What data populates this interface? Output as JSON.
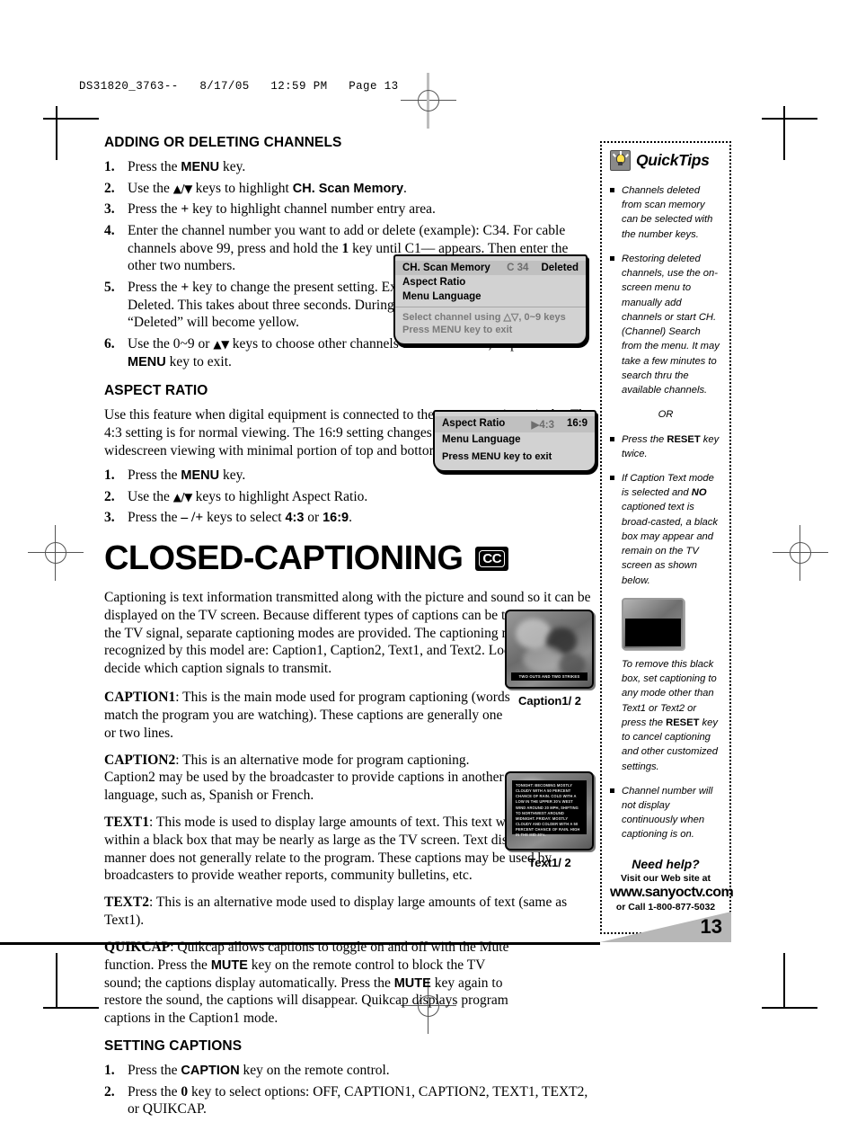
{
  "print_header": "DS31820_3763--   8/17/05   12:59 PM   Page 13",
  "sections": {
    "adding": {
      "heading": "ADDING OR DELETING CHANNELS",
      "steps": [
        {
          "num": "1.",
          "html": "Press the <span class=\"b\">MENU</span> key."
        },
        {
          "num": "2.",
          "html": "Use the <span class=\"ar\">▲/▼</span> keys to highlight <span class=\"b\">CH. Scan Memory</span>."
        },
        {
          "num": "3.",
          "html": "Press the <span class=\"bs\">+</span> key to highlight channel number entry area."
        },
        {
          "num": "4.",
          "html": "Enter the channel number you want to add or delete (example):  C34. For cable channels above 99, press and hold the <span class=\"bs\">1</span> key until C1&ndash;&ndash; appears. Then enter the other two numbers."
        },
        {
          "num": "5.",
          "html": "Press the <span class=\"bs\">+</span> key to change the present setting. Example: Added will change to Deleted. This takes about three seconds. During that time, the word &ldquo;Added&rdquo; or &ldquo;Deleted&rdquo; will become yellow."
        },
        {
          "num": "6.",
          "html": "Use the 0~9 or <span class=\"ar\">▲▼</span> keys to choose other channels to delete or add, or press the <span class=\"b\">MENU</span> key to exit."
        }
      ]
    },
    "aspect": {
      "heading": "ASPECT RATIO",
      "body": "Use this feature when digital equipment is connected to the component input jacks. The 4:3 setting is for normal viewing. The 16:9 setting changes the picture image to widescreen viewing with minimal portion of top and bottom compressed.",
      "steps": [
        {
          "num": "1.",
          "html": "Press the <span class=\"b\">MENU</span> key."
        },
        {
          "num": "2.",
          "html": "Use the <span class=\"ar\">▲/▼</span> keys to highlight Aspect Ratio."
        },
        {
          "num": "3.",
          "html": "Press the <span class=\"bs\">– /+</span> keys to select <span class=\"b\">4:3</span> or <span class=\"b\">16:9</span>."
        }
      ]
    },
    "closed_captioning": {
      "title": "CLOSED-CAPTIONING",
      "badge": "CC",
      "intro": "Captioning is text information transmitted along with the picture and sound so it can be displayed on the TV screen. Because different types of captions can be transmitted with the TV signal, separate captioning modes are provided. The captioning modes recognized by this model are: Caption1, Caption2, Text1, and Text2. Local broadcasters decide which caption signals to transmit.",
      "modes": [
        {
          "label": "CAPTION1",
          "text": ": This is the main mode used for program captioning (words match the program you are watching). These captions are generally one or two lines."
        },
        {
          "label": "CAPTION2",
          "text": ": This is an alternative mode for program captioning. Caption2 may be used by the broadcaster to provide captions in another language, such as, Spanish or French."
        },
        {
          "label": "TEXT1",
          "text": ": This mode is used to display large amounts of text. This text will appear within a black box that may be nearly as large as the TV screen. Text displayed in this manner does not generally relate to the program. These captions may be used by broadcasters to provide weather reports, community bulletins, etc."
        },
        {
          "label": "TEXT2",
          "text": ": This is an alternative mode used to display large amounts of text (same as Text1)."
        }
      ],
      "quikcap_label": "QUIKCAP",
      "quikcap_html": ":  Quikcap allows captions to toggle on and off with the Mute function. Press the <span class=\"b\">MUTE</span> key on the remote control to block the TV sound; the captions display automatically. Press the <span class=\"b\">MUTE</span> key again to restore the sound, the captions will disappear. Quikcap displays program captions in the Caption1 mode."
    },
    "setting_captions": {
      "heading": "SETTING CAPTIONS",
      "steps": [
        {
          "num": "1.",
          "html": "Press the <span class=\"b\">CAPTION</span> key on the remote control."
        },
        {
          "num": "2.",
          "html": "Press the <span class=\"bs\">0</span> key to select options: OFF, CAPTION1, CAPTION2, TEXT1, TEXT2, or QUIKCAP."
        }
      ]
    }
  },
  "osd_channel": {
    "rows": [
      {
        "label": "CH. Scan Memory",
        "mid": "C 34",
        "right": "Deleted",
        "highlight": true
      },
      {
        "label": "Aspect Ratio",
        "mid": "",
        "right": "",
        "highlight": false
      },
      {
        "label": "Menu Language",
        "mid": "",
        "right": "",
        "highlight": false
      }
    ],
    "footer": [
      "Select channel using △▽, 0~9 keys",
      "Press MENU key to exit"
    ]
  },
  "osd_aspect": {
    "rows": [
      {
        "label": "Aspect Ratio",
        "mid": "▶4:3",
        "right": "16:9",
        "highlight": true
      },
      {
        "label": "Menu Language",
        "mid": "",
        "right": "",
        "highlight": false
      }
    ],
    "footer": [
      "Press MENU key to exit"
    ]
  },
  "thumbnails": {
    "caption": {
      "caption_text": "TWO OUTS AND TWO STRIKES",
      "label": "Caption1/ 2"
    },
    "text": {
      "body": "TONIGHT: BECOMING MOSTLY CLOUDY WITH A 50 PERCENT CHANCE OF RAIN. COLD WITH A LOW IN THE UPPER 30's WEST WIND AROUND 20 MPH, SHIFTING TO NORTHWEST AROUND MIDNIGHT. FRIDAY: MOSTLY CLOUDY AND COLDER WITH A 50 PERCENT CHANCE OF RAIN. HIGH IN THE MID 30's.",
      "label": "Text1/ 2"
    }
  },
  "quicktips": {
    "title": "QuickTips",
    "icon": "lightbulb-icon",
    "tips": [
      {
        "type": "bullet",
        "html": "Channels deleted from scan memory can be selected with the number keys."
      },
      {
        "type": "bullet",
        "html": "Restoring deleted channels, use the on-screen menu to manually add channels or start CH. (Channel) Search from the menu. It may take a few minutes to search thru the available channels."
      },
      {
        "type": "center",
        "html": "OR"
      },
      {
        "type": "bullet",
        "html": "Press the <b>RESET</b> key twice."
      },
      {
        "type": "bullet",
        "html": "If Caption Text mode is selected and <i>NO</i> captioned text is broad-casted, a black box may appear and remain on the TV screen as shown below."
      },
      {
        "type": "image",
        "html": ""
      },
      {
        "type": "plain",
        "html": "To remove this black box, set captioning to any mode other than Text1 or Text2 or press the <b>RESET</b> key to cancel captioning and other customized settings."
      },
      {
        "type": "bullet",
        "html": "Channel number will not display continuously when captioning is on."
      }
    ],
    "need_help": {
      "line1": "Need help?",
      "line2": "Visit our Web site at",
      "line3": "www.sanyoctv.com",
      "line4": "or Call 1-800-877-5032"
    }
  },
  "page_number": "13"
}
